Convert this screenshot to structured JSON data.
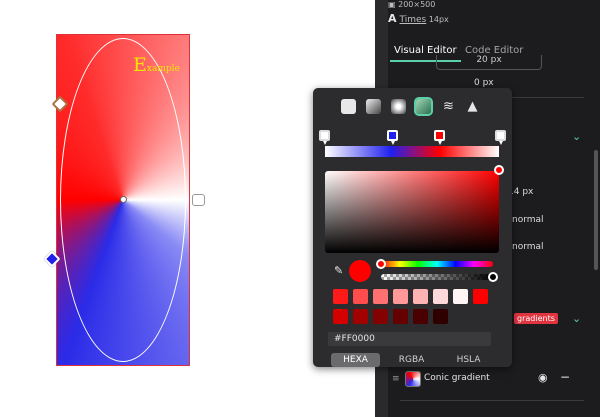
{
  "canvas": {
    "art_text_big": "E",
    "art_text_small": "xample"
  },
  "panel": {
    "size_label": "200×500",
    "font_name": "Times",
    "font_size": "14px",
    "font_icon": "A",
    "tabs": [
      "Visual Editor",
      "Code Editor"
    ],
    "padding_value": "0 px",
    "font_size_value": "14 px",
    "weight_value_1": "normal",
    "weight_value_2": "normal",
    "gradient_badge": "gradients",
    "layer": {
      "drag_icon": "≡",
      "name": "Conic gradient",
      "eye_icon": "👁",
      "minus_icon": "−"
    }
  },
  "picker": {
    "types": [
      "solid",
      "linear-gradient",
      "radial-gradient",
      "conic-gradient",
      "pattern",
      "image"
    ],
    "active_type": "conic-gradient",
    "stops": [
      {
        "color": "#ffffff",
        "position": 0
      },
      {
        "color": "#2020ee",
        "position": 38
      },
      {
        "color": "#ff0000",
        "position": 66
      },
      {
        "color": "#ffffff",
        "position": 100
      }
    ],
    "current_color": "#FF0000",
    "hex_value": "#FF0000",
    "swatches_row1": [
      "#ff1a1a",
      "#ff4d4d",
      "#ff7070",
      "#ff9999",
      "#ffb3b3",
      "#ffd9d9",
      "#fff5f5",
      "#ff0000"
    ],
    "swatches_row2": [
      "#d40000",
      "#a30000",
      "#850000",
      "#660000",
      "#4a0000",
      "#2e0000"
    ],
    "modes": [
      "HEXA",
      "RGBA",
      "HSLA"
    ],
    "active_mode": "HEXA",
    "colors": {
      "accent": "#5bd0a8",
      "badge": "#e0343f"
    }
  }
}
